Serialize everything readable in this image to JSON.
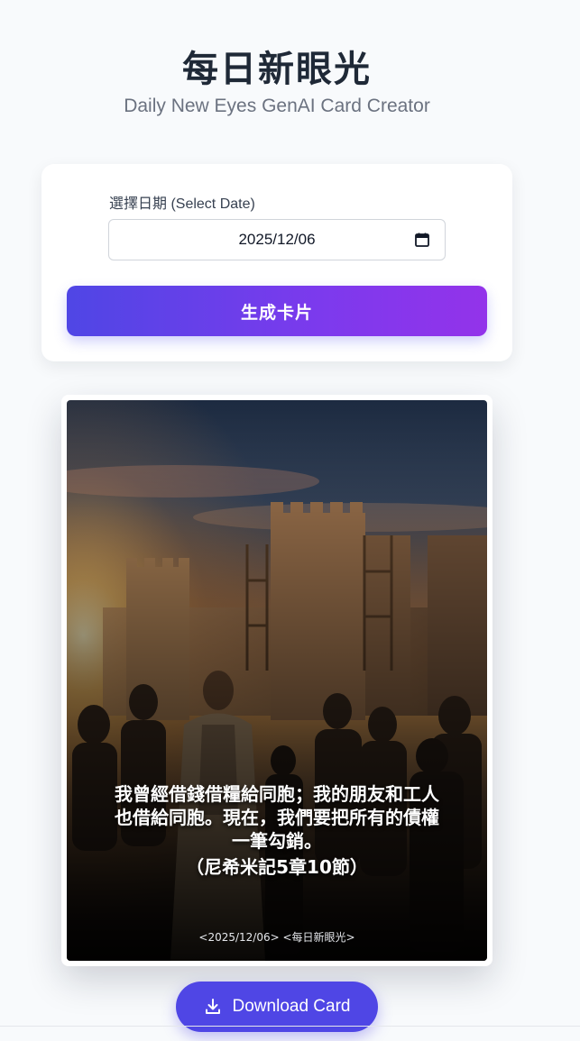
{
  "header": {
    "title": "每日新眼光",
    "subtitle": "Daily New Eyes GenAI Card Creator"
  },
  "form": {
    "date_label": "選擇日期 (Select Date)",
    "date_value": "2025/12/06",
    "generate_label": "生成卡片"
  },
  "card": {
    "verse_lines": [
      "我曾經借錢借糧給同胞；我的朋友和工人",
      "也借給同胞。現在，我們要把所有的債權",
      "一筆勾銷。"
    ],
    "reference": "（尼希米記5章10節）",
    "footer": "<2025/12/06> <每日新眼光>"
  },
  "download": {
    "label": "Download Card",
    "icon": "download-icon"
  },
  "colors": {
    "accent": "#4f46e5",
    "gradient_end": "#9333ea",
    "background": "#f8fafc"
  }
}
